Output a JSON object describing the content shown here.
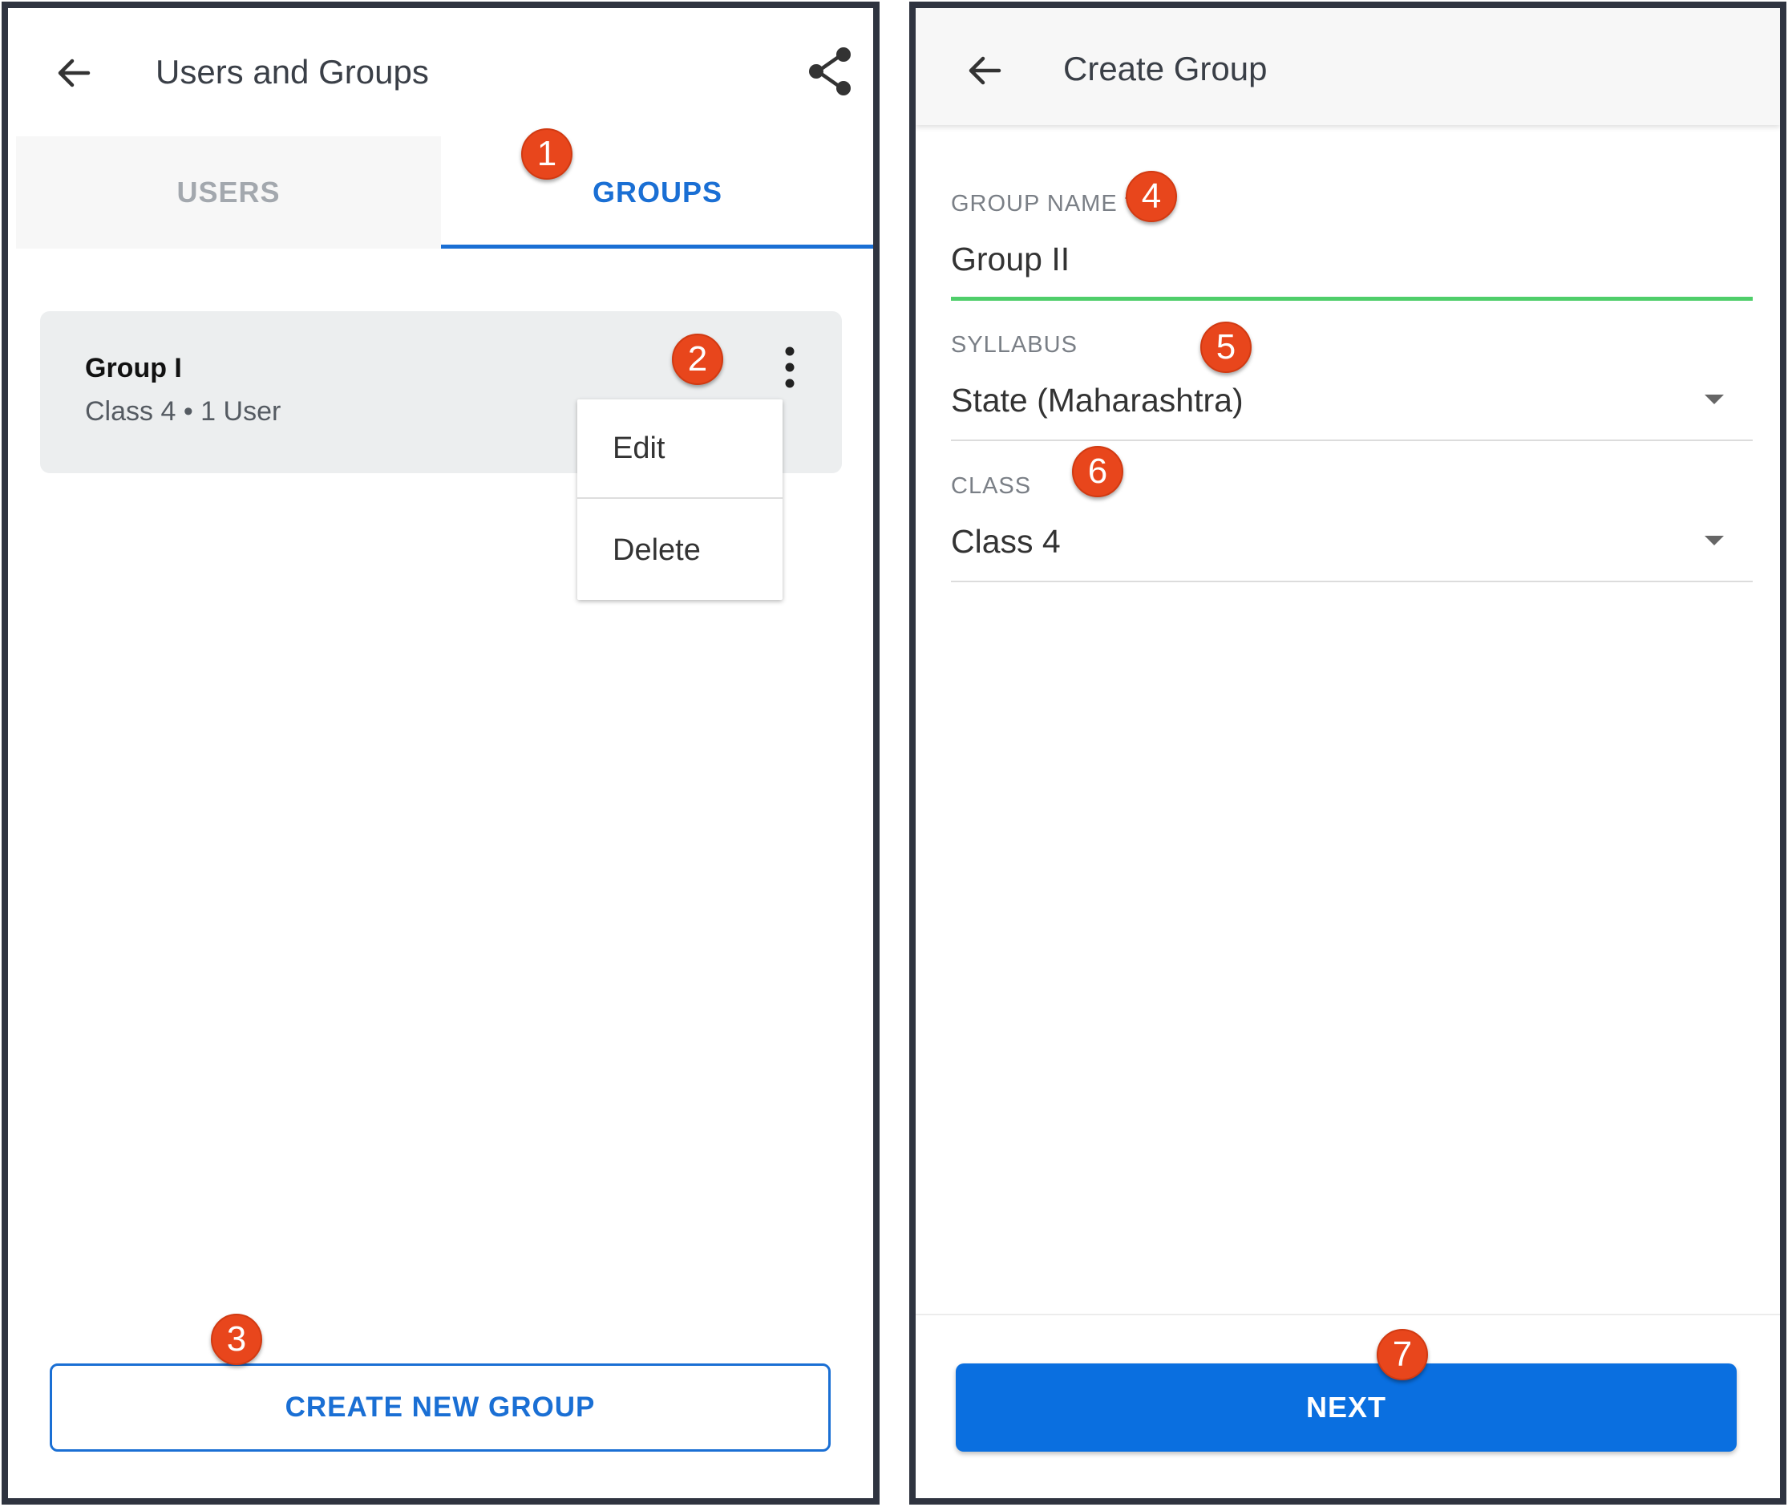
{
  "users_groups_screen": {
    "title": "Users and Groups",
    "tabs": [
      {
        "label": "USERS",
        "active": false
      },
      {
        "label": "GROUPS",
        "active": true
      }
    ],
    "groups": [
      {
        "name": "Group I",
        "subtitle": "Class 4 • 1 User"
      }
    ],
    "context_menu": {
      "items": [
        "Edit",
        "Delete"
      ]
    },
    "create_button_label": "CREATE NEW GROUP"
  },
  "create_group_screen": {
    "title": "Create Group",
    "fields": {
      "group_name": {
        "label": "GROUP NAME",
        "required_mark": "*",
        "value": "Group II"
      },
      "syllabus": {
        "label": "SYLLABUS",
        "value": "State (Maharashtra)"
      },
      "class": {
        "label": "CLASS",
        "value": "Class 4"
      }
    },
    "next_button_label": "NEXT"
  },
  "callouts": [
    "1",
    "2",
    "3",
    "4",
    "5",
    "6",
    "7"
  ],
  "colors": {
    "accent_blue": "#1a6fd4",
    "primary_button": "#0a6fe0",
    "callout": "#e8461c",
    "active_field_line": "#4fce6a",
    "frame": "#2f3440"
  },
  "icons": [
    "back-arrow-icon",
    "share-icon",
    "kebab-menu-icon",
    "dropdown-arrow-icon"
  ]
}
